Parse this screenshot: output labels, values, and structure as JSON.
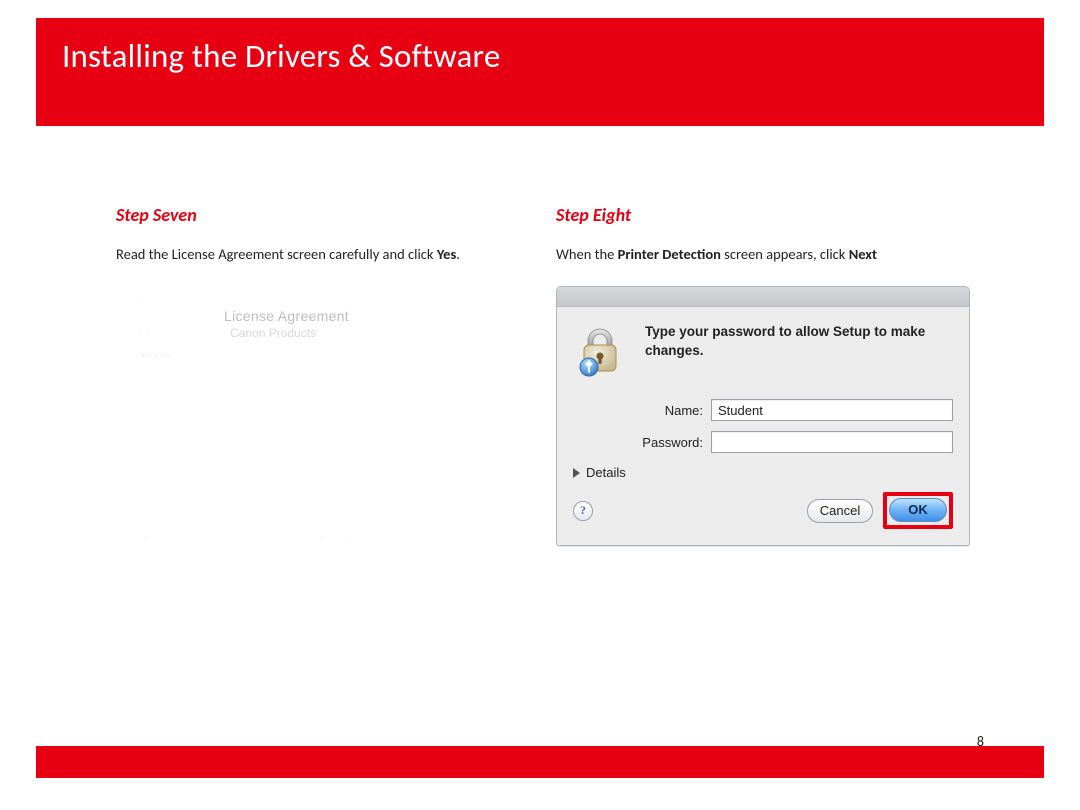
{
  "header": {
    "title": "Installing  the Drivers & Software"
  },
  "left": {
    "step_title": "Step Seven",
    "text_pre": "Read the License Agreement screen carefully and click ",
    "text_bold": "Yes",
    "text_post": ".",
    "license": {
      "title": "License Agreement",
      "subtitle": "Canon Products"
    }
  },
  "right": {
    "step_title": "Step Eight",
    "text_pre": "When the ",
    "text_bold1": "Printer Detection",
    "text_mid": " screen appears, click ",
    "text_bold2": "Next",
    "dialog": {
      "message": "Type your password to allow Setup to make changes.",
      "name_label": "Name:",
      "name_value": "Student",
      "password_label": "Password:",
      "password_value": "",
      "details_label": "Details",
      "help_glyph": "?",
      "cancel": "Cancel",
      "ok": "OK"
    }
  },
  "page_number": "8"
}
